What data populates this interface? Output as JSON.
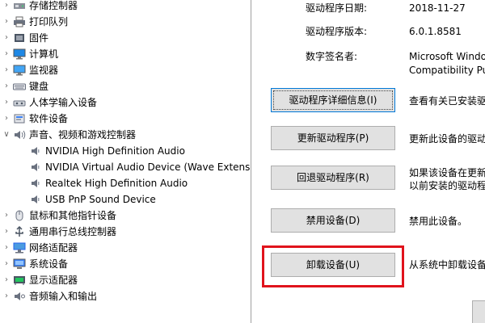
{
  "tree": {
    "items": [
      {
        "label": "存储控制器",
        "icon": "storage-controller-icon",
        "expander": "collapsed"
      },
      {
        "label": "打印队列",
        "icon": "printer-icon",
        "expander": "collapsed"
      },
      {
        "label": "固件",
        "icon": "firmware-icon",
        "expander": "collapsed"
      },
      {
        "label": "计算机",
        "icon": "computer-icon",
        "expander": "collapsed"
      },
      {
        "label": "监视器",
        "icon": "monitor-icon",
        "expander": "collapsed"
      },
      {
        "label": "键盘",
        "icon": "keyboard-icon",
        "expander": "collapsed"
      },
      {
        "label": "人体学输入设备",
        "icon": "hid-icon",
        "expander": "collapsed"
      },
      {
        "label": "软件设备",
        "icon": "software-device-icon",
        "expander": "collapsed"
      },
      {
        "label": "声音、视频和游戏控制器",
        "icon": "sound-controller-icon",
        "expander": "expanded"
      },
      {
        "label": "NVIDIA High Definition Audio",
        "icon": "speaker-icon",
        "child": true
      },
      {
        "label": "NVIDIA Virtual Audio Device (Wave Extensible)",
        "icon": "speaker-icon",
        "child": true
      },
      {
        "label": "Realtek High Definition Audio",
        "icon": "speaker-icon",
        "child": true
      },
      {
        "label": "USB PnP Sound Device",
        "icon": "speaker-icon",
        "child": true
      },
      {
        "label": "鼠标和其他指针设备",
        "icon": "mouse-icon",
        "expander": "collapsed"
      },
      {
        "label": "通用串行总线控制器",
        "icon": "usb-icon",
        "expander": "collapsed"
      },
      {
        "label": "网络适配器",
        "icon": "network-adapter-icon",
        "expander": "collapsed"
      },
      {
        "label": "系统设备",
        "icon": "system-device-icon",
        "expander": "collapsed"
      },
      {
        "label": "显示适配器",
        "icon": "display-adapter-icon",
        "expander": "collapsed"
      },
      {
        "label": "音频输入和输出",
        "icon": "audio-io-icon",
        "expander": "collapsed"
      }
    ]
  },
  "driver": {
    "date_label": "驱动程序日期:",
    "date_value": "2018-11-27",
    "version_label": "驱动程序版本:",
    "version_value": "6.0.1.8581",
    "signer_label": "数字签名者:",
    "signer_value_line1": "Microsoft Windows Hardware",
    "signer_value_line2": "Compatibility Publisher"
  },
  "buttons": {
    "details_label": "驱动程序详细信息(I)",
    "details_desc": "查看有关已安装驱动程序文件的详细信息。",
    "update_label": "更新驱动程序(P)",
    "update_desc": "更新此设备的驱动程序。",
    "rollback_label": "回退驱动程序(R)",
    "rollback_desc_line1": "如果该设备在更新驱动程序时失败，则",
    "rollback_desc_line2": "以前安装的驱动程序。",
    "disable_label": "禁用设备(D)",
    "disable_desc": "禁用此设备。",
    "uninstall_label": "卸载设备(U)",
    "uninstall_desc": "从系统中卸载设备(高级)。"
  },
  "colors": {
    "highlight": "#e0131c",
    "button_face": "#e1e1e1",
    "focus_border": "#0078d7"
  }
}
